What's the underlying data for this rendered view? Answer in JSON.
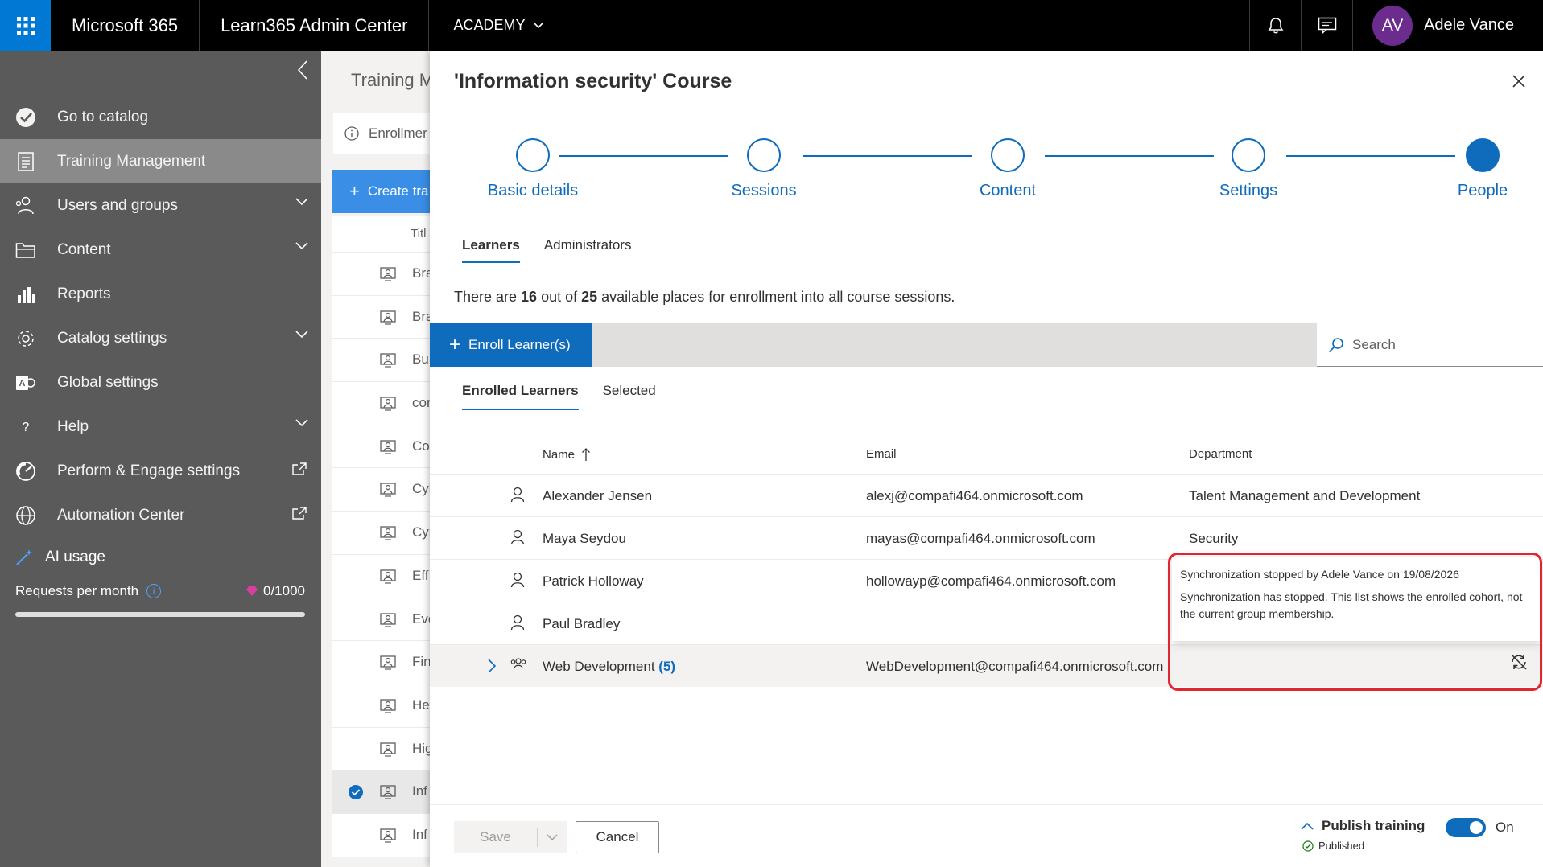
{
  "topbar": {
    "brand": "Microsoft 365",
    "app": "Learn365 Admin Center",
    "academy": "ACADEMY",
    "user_initials": "AV",
    "user_name": "Adele Vance",
    "avatar_color": "#6b2c8e"
  },
  "sidebar": {
    "items": [
      {
        "label": "Go to catalog",
        "icon": "catalog-check-icon"
      },
      {
        "label": "Training Management",
        "icon": "training-doc-icon",
        "active": true
      },
      {
        "label": "Users and groups",
        "icon": "users-icon",
        "expandable": true
      },
      {
        "label": "Content",
        "icon": "folder-icon",
        "expandable": true
      },
      {
        "label": "Reports",
        "icon": "bar-chart-icon"
      },
      {
        "label": "Catalog settings",
        "icon": "gear-icon",
        "expandable": true
      },
      {
        "label": "Global settings",
        "icon": "global-settings-icon"
      },
      {
        "label": "Help",
        "icon": "help-icon",
        "expandable": true
      },
      {
        "label": "Perform & Engage settings",
        "icon": "gauge-icon",
        "external": true
      },
      {
        "label": "Automation Center",
        "icon": "globe-icon",
        "external": true
      }
    ],
    "ai": {
      "title": "AI usage",
      "requests_label": "Requests per month",
      "requests_value": "0/1000",
      "usage_fraction": 0
    }
  },
  "background_page": {
    "title": "Training M",
    "enrollment": "Enrollmer",
    "create_button": "Create tra",
    "title_header": "Titl",
    "rows": [
      "Bra",
      "Bra",
      "Bu",
      "cor",
      "Co",
      "Cyl",
      "Cyl",
      "Eff",
      "Eve",
      "Fin",
      "He",
      "Hig",
      "Inf",
      "Inf"
    ],
    "selected_index": 12
  },
  "panel": {
    "title": "'Information security' Course",
    "steps": [
      {
        "label": "Basic details",
        "done": false
      },
      {
        "label": "Sessions",
        "done": false
      },
      {
        "label": "Content",
        "done": false
      },
      {
        "label": "Settings",
        "done": false
      },
      {
        "label": "People",
        "done": true
      }
    ],
    "tabs": [
      "Learners",
      "Administrators"
    ],
    "info": {
      "prefix": "There are ",
      "enrolled": "16",
      "middle": " out of ",
      "total": "25",
      "suffix": " available places for enrollment into all course sessions."
    },
    "enroll_button": "Enroll Learner(s)",
    "search_placeholder": "Search",
    "subtabs": [
      "Enrolled Learners",
      "Selected"
    ],
    "columns": {
      "name": "Name",
      "email": "Email",
      "department": "Department"
    },
    "rows": [
      {
        "name": "Alexander Jensen",
        "email": "alexj@compafi464.onmicrosoft.com",
        "department": "Talent Management and Development"
      },
      {
        "name": "Maya Seydou",
        "email": "mayas@compafi464.onmicrosoft.com",
        "department": "Security"
      },
      {
        "name": "Patrick Holloway",
        "email": "hollowayp@compafi464.onmicrosoft.com",
        "department": ""
      },
      {
        "name": "Paul Bradley",
        "email": "",
        "department": ""
      }
    ],
    "group_row": {
      "name": "Web Development",
      "count": "(5)",
      "email": "WebDevelopment@compafi464.onmicrosoft.com"
    },
    "tooltip": {
      "line1": "Synchronization stopped by Adele Vance on 19/08/2026",
      "line2": "Synchronization has stopped. This list shows the enrolled cohort, not the current group membership."
    },
    "footer": {
      "save": "Save",
      "cancel": "Cancel",
      "publish": "Publish training",
      "status": "Published",
      "toggle": "On"
    }
  },
  "colors": {
    "accent": "#0f6cbd",
    "sidebar": "#5a5a5a",
    "highlight": "#e0262f"
  }
}
